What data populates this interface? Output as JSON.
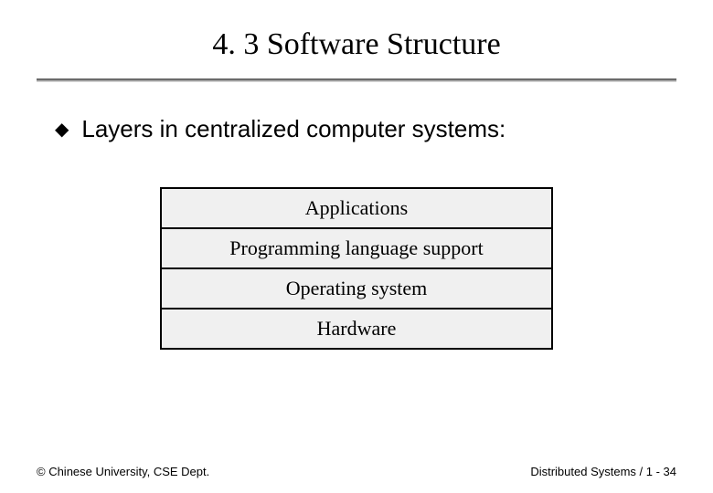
{
  "title": "4. 3 Software Structure",
  "bullet": {
    "glyph": "◆",
    "text": "Layers in centralized computer systems:"
  },
  "layers": [
    "Applications",
    "Programming language support",
    "Operating system",
    "Hardware"
  ],
  "footer": {
    "left": "© Chinese University, CSE Dept.",
    "right": "Distributed Systems / 1 - 34"
  }
}
